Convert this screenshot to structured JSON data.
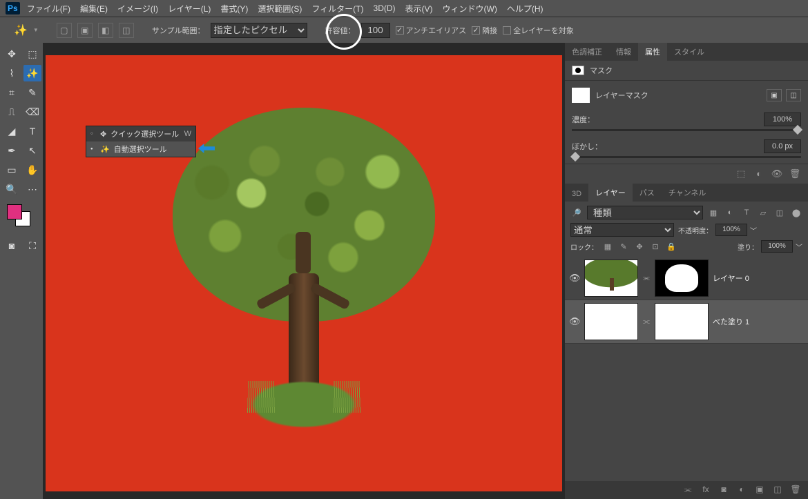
{
  "menu": {
    "items": [
      "ファイル(F)",
      "編集(E)",
      "イメージ(I)",
      "レイヤー(L)",
      "書式(Y)",
      "選択範囲(S)",
      "フィルター(T)",
      "3D(D)",
      "表示(V)",
      "ウィンドウ(W)",
      "ヘルプ(H)"
    ]
  },
  "opts": {
    "sample_label": "サンプル範囲：",
    "sample_sel": "指定したピクセル",
    "tol_label": "許容値：",
    "tol_val": "100",
    "aa_label": "アンチエイリアス",
    "contig_label": "隣接",
    "all_label": "全レイヤーを対象"
  },
  "flyout": {
    "quick": "クイック選択ツール",
    "quick_key": "W",
    "magic": "自動選択ツール"
  },
  "props": {
    "tabs": [
      "色調補正",
      "情報",
      "属性",
      "スタイル"
    ],
    "mask_title": "マスク",
    "layermask": "レイヤーマスク",
    "density_lbl": "濃度：",
    "density_val": "100%",
    "feather_lbl": "ぼかし：",
    "feather_val": "0.0 px"
  },
  "layp": {
    "tabs": [
      "3D",
      "レイヤー",
      "パス",
      "チャンネル"
    ],
    "search": "種類",
    "mode": "通常",
    "opac_lbl": "不透明度：",
    "opac_val": "100%",
    "lock_lbl": "ロック：",
    "fill_lbl": "塗り：",
    "fill_val": "100%",
    "layers": [
      {
        "name": "レイヤー 0"
      },
      {
        "name": "べた塗り 1"
      }
    ]
  }
}
